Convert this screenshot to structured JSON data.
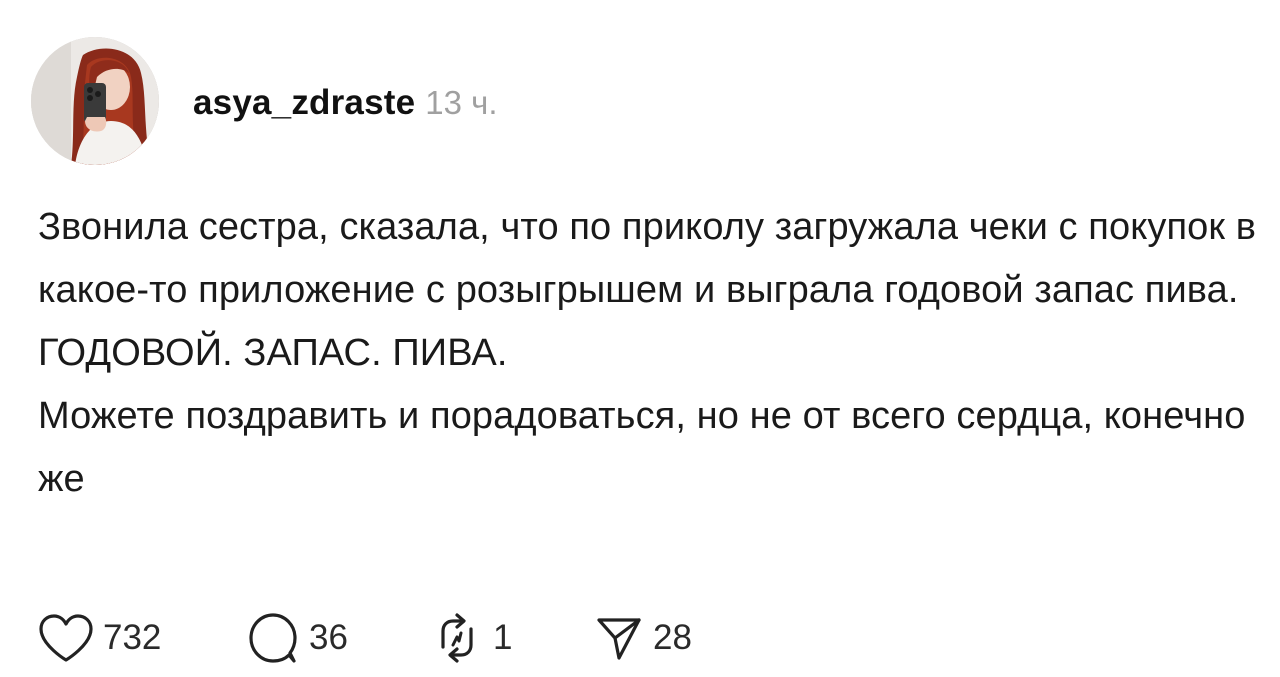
{
  "post": {
    "author": {
      "username": "asya_zdraste",
      "time": "13 ч."
    },
    "text": {
      "line1": "Звонила сестра, сказала, что по приколу загружала чеки с покупок в какое-то приложение с розыгрышем и выграла годовой запас пива.",
      "line2": "ГОДОВОЙ. ЗАПАС. ПИВА.",
      "line3": "Можете поздравить и порадоваться, но не от всего сердца, конечно же"
    },
    "actions": {
      "likes": "732",
      "replies": "36",
      "reposts": "1",
      "shares": "28"
    },
    "icons": {
      "like": "heart-icon",
      "reply": "comment-icon",
      "repost": "repost-icon",
      "share": "send-icon"
    }
  }
}
